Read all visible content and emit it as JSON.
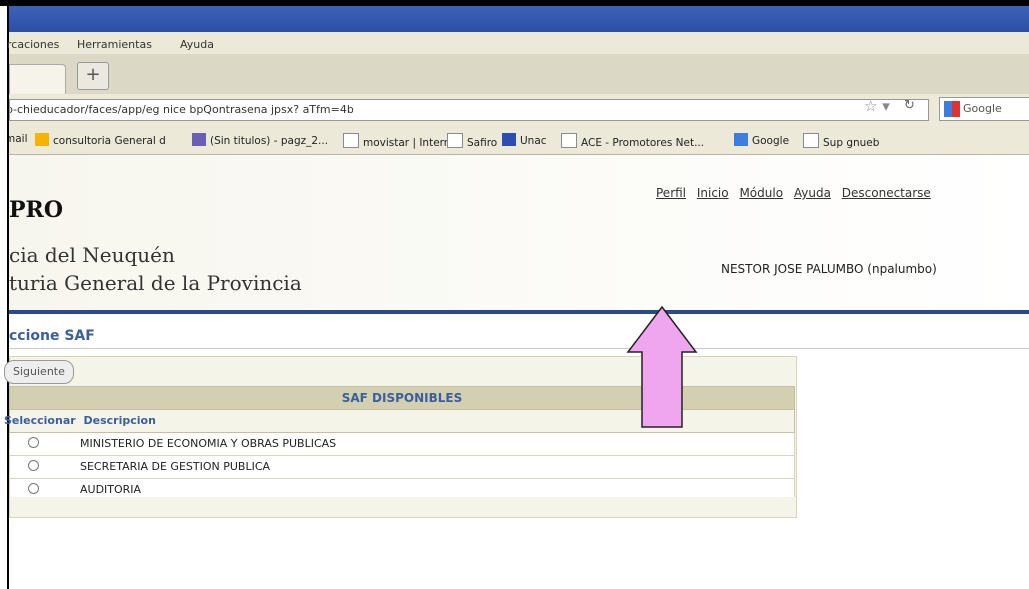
{
  "browser": {
    "menu": [
      "rcaciones",
      "Herramientas",
      "Ayuda"
    ],
    "new_tab": "+",
    "url": "p-chieducador/faces/app/eg nice bpQontrasena jpsx? aTfm=4b",
    "search_engine": "Google",
    "bookmarks": [
      "mail",
      "consultoria General d",
      "(Sin titulos) - pagz_2...",
      "movistar | Internet",
      "Safiro",
      "Unac",
      "ACE - Promotores Net...",
      "Google",
      "Sup gnueb"
    ]
  },
  "header": {
    "brand": "PRO",
    "subtitle1": "cia del Neuquén",
    "subtitle2": "turia General de la Provincia",
    "links": [
      "Perfil",
      "Inicio",
      "Módulo",
      "Ayuda",
      "Desconectarse"
    ],
    "user": "NESTOR JOSE PALUMBO (npalumbo)"
  },
  "section": {
    "title": "ccione SAF",
    "next_button": "Siguiente"
  },
  "table": {
    "title": "SAF DISPONIBLES",
    "columns": [
      "Seleccionar",
      "Descripcion"
    ],
    "rows": [
      "MINISTERIO DE ECONOMIA Y OBRAS PUBLICAS",
      "SECRETARIA DE GESTION PUBLICA",
      "AUDITORIA"
    ]
  },
  "annotation": {
    "arrow_color": "#f0a6ee"
  }
}
